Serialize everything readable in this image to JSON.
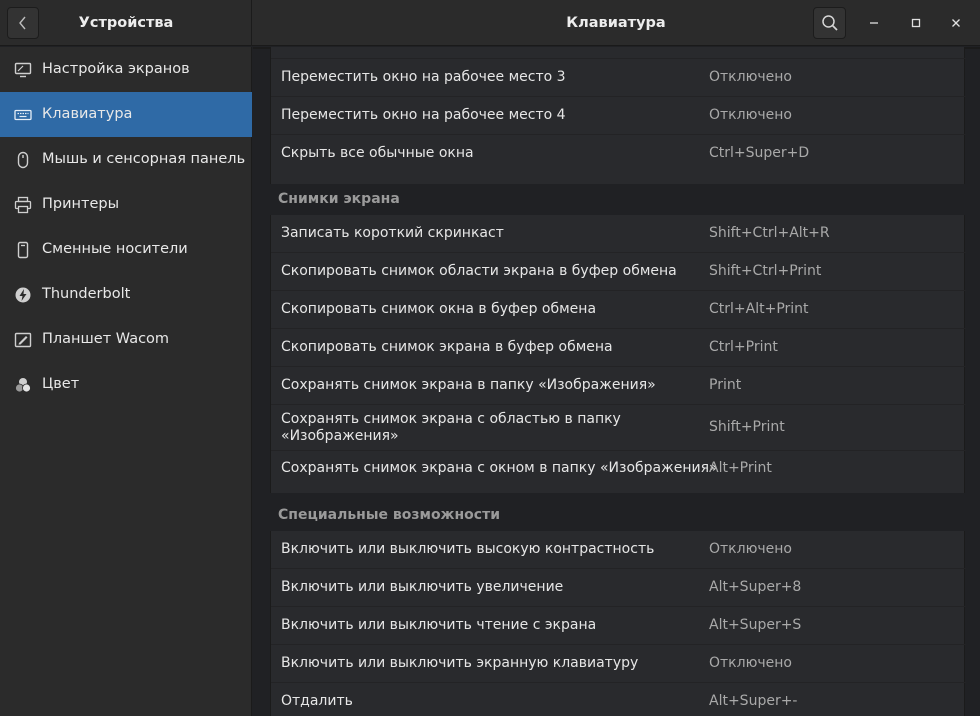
{
  "header": {
    "sidebar_title": "Устройства",
    "main_title": "Клавиатура"
  },
  "sidebar": {
    "items": [
      {
        "label": "Настройка экранов",
        "icon": "display-icon"
      },
      {
        "label": "Клавиатура",
        "icon": "keyboard-icon",
        "active": true
      },
      {
        "label": "Мышь и сенсорная панель",
        "icon": "mouse-icon"
      },
      {
        "label": "Принтеры",
        "icon": "printer-icon"
      },
      {
        "label": "Сменные носители",
        "icon": "removable-media-icon"
      },
      {
        "label": "Thunderbolt",
        "icon": "thunderbolt-icon"
      },
      {
        "label": "Планшет Wacom",
        "icon": "wacom-tablet-icon"
      },
      {
        "label": "Цвет",
        "icon": "color-icon"
      }
    ]
  },
  "shortcuts": {
    "group1": [
      {
        "name": "Переместить окно на рабочее место 3",
        "key": "Отключено"
      },
      {
        "name": "Переместить окно на рабочее место 4",
        "key": "Отключено"
      },
      {
        "name": "Скрыть все обычные окна",
        "key": "Ctrl+Super+D"
      }
    ],
    "screenshots_title": "Снимки экрана",
    "screenshots": [
      {
        "name": "Записать короткий скринкаст",
        "key": "Shift+Ctrl+Alt+R"
      },
      {
        "name": "Скопировать снимок области экрана в буфер обмена",
        "key": "Shift+Ctrl+Print"
      },
      {
        "name": "Скопировать снимок окна в буфер обмена",
        "key": "Ctrl+Alt+Print"
      },
      {
        "name": "Скопировать снимок экрана в буфер обмена",
        "key": "Ctrl+Print"
      },
      {
        "name": "Сохранять снимок экрана в папку «Изображения»",
        "key": "Print"
      },
      {
        "name": "Сохранять снимок экрана с областью в папку «Изображения»",
        "key": "Shift+Print"
      },
      {
        "name": "Сохранять снимок экрана с окном в папку «Изображения»",
        "key": "Alt+Print"
      }
    ],
    "accessibility_title": "Специальные возможности",
    "accessibility": [
      {
        "name": "Включить или выключить высокую контрастность",
        "key": "Отключено"
      },
      {
        "name": "Включить или выключить увеличение",
        "key": "Alt+Super+8"
      },
      {
        "name": "Включить или выключить чтение с экрана",
        "key": "Alt+Super+S"
      },
      {
        "name": "Включить или выключить экранную клавиатуру",
        "key": "Отключено"
      },
      {
        "name": "Отдалить",
        "key": "Alt+Super+-"
      }
    ]
  }
}
